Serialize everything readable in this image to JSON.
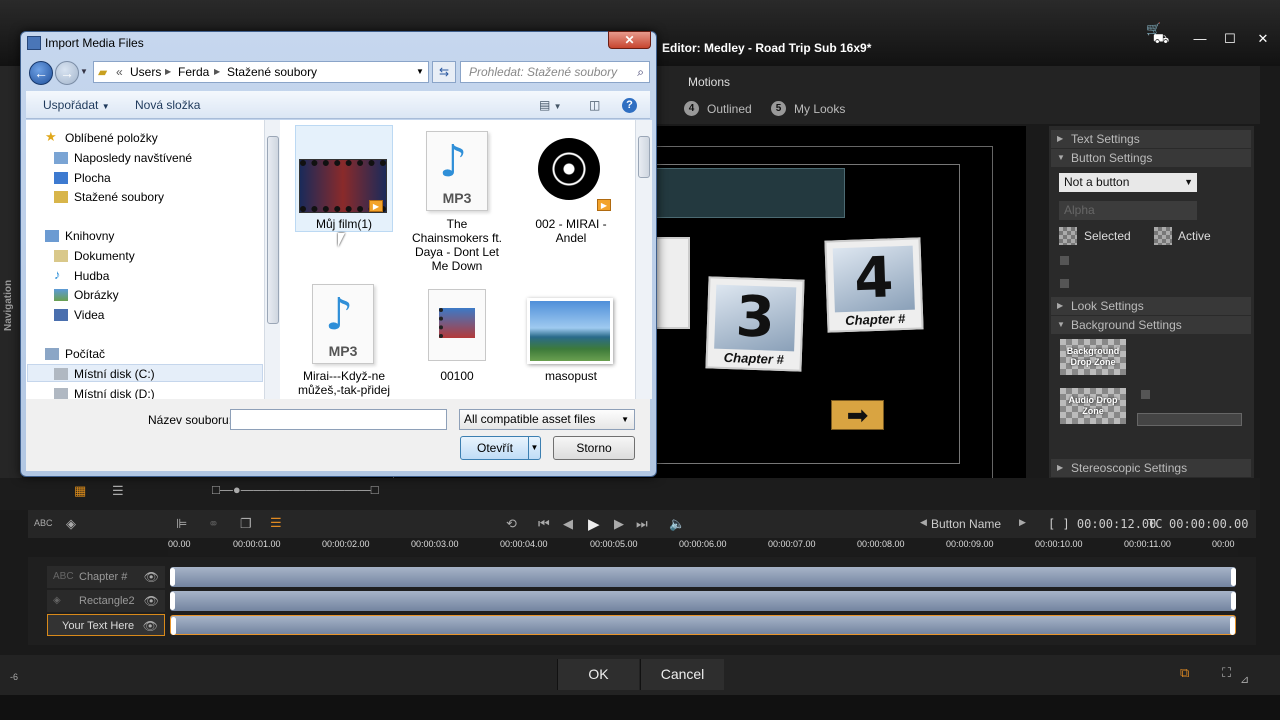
{
  "editor": {
    "title": "Editor: Medley - Road Trip Sub 16x9*",
    "nav_label": "Navigation",
    "motions_label": "Motions",
    "look_tabs": [
      {
        "num": "4",
        "label": "Outlined"
      },
      {
        "num": "5",
        "label": "My Looks"
      }
    ],
    "chapters": [
      {
        "num": "3",
        "caption": "Chapter #"
      },
      {
        "num": "4",
        "caption": "Chapter #"
      }
    ],
    "settings": {
      "text_settings": "Text Settings",
      "button_settings": "Button Settings",
      "button_type": "Not a button",
      "alpha": "Alpha",
      "selected": "Selected",
      "active": "Active",
      "look_settings": "Look Settings",
      "background_settings": "Background Settings",
      "background_drop_zone": "Background Drop Zone",
      "audio_drop_zone": "Audio Drop Zone",
      "stereoscopic_settings": "Stereoscopic Settings"
    },
    "transport": {
      "button_name": "Button Name",
      "duration": "[ ] 00:00:12.00",
      "tc_label": "TC",
      "timecode": "00:00:00.00"
    },
    "ruler": [
      "00.00",
      "00:00:01.00",
      "00:00:02.00",
      "00:00:03.00",
      "00:00:04.00",
      "00:00:05.00",
      "00:00:06.00",
      "00:00:07.00",
      "00:00:08.00",
      "00:00:09.00",
      "00:00:10.00",
      "00:00:11.00",
      "00:00"
    ],
    "tracks": [
      {
        "name": "Chapter #"
      },
      {
        "name": "Rectangle2"
      },
      {
        "name": "Your Text Here"
      }
    ],
    "ok": "OK",
    "cancel": "Cancel",
    "level": "-6"
  },
  "dialog": {
    "title": "Import Media Files",
    "close": "✕",
    "path": [
      "Users",
      "Ferda",
      "Stažené soubory"
    ],
    "search_placeholder": "Prohledat: Stažené soubory",
    "organize": "Uspořádat",
    "new_folder": "Nová složka",
    "nav": {
      "favorites": "Oblíbené položky",
      "recent": "Naposledy navštívené",
      "desktop": "Plocha",
      "downloads": "Stažené soubory",
      "libraries": "Knihovny",
      "documents": "Dokumenty",
      "music": "Hudba",
      "pictures": "Obrázky",
      "videos": "Videa",
      "computer": "Počítač",
      "disk_c": "Místní disk (C:)",
      "disk_d": "Místní disk (D:)"
    },
    "files": [
      {
        "name": "Můj film(1)",
        "type": "video"
      },
      {
        "name": "The Chainsmokers ft. Daya - Dont Let Me Down",
        "type": "mp3"
      },
      {
        "name": "002 - MIRAI - Andel",
        "type": "music-video"
      },
      {
        "name": "Mirai---Když-ne můžeš,-tak-přidej",
        "type": "mp3"
      },
      {
        "name": "00100",
        "type": "video"
      },
      {
        "name": "masopust",
        "type": "image"
      }
    ],
    "mp3_label": "MP3",
    "filename_label": "Název souboru:",
    "filename_value": "",
    "filter": "All compatible asset files",
    "open": "Otevřít",
    "cancel": "Storno"
  }
}
